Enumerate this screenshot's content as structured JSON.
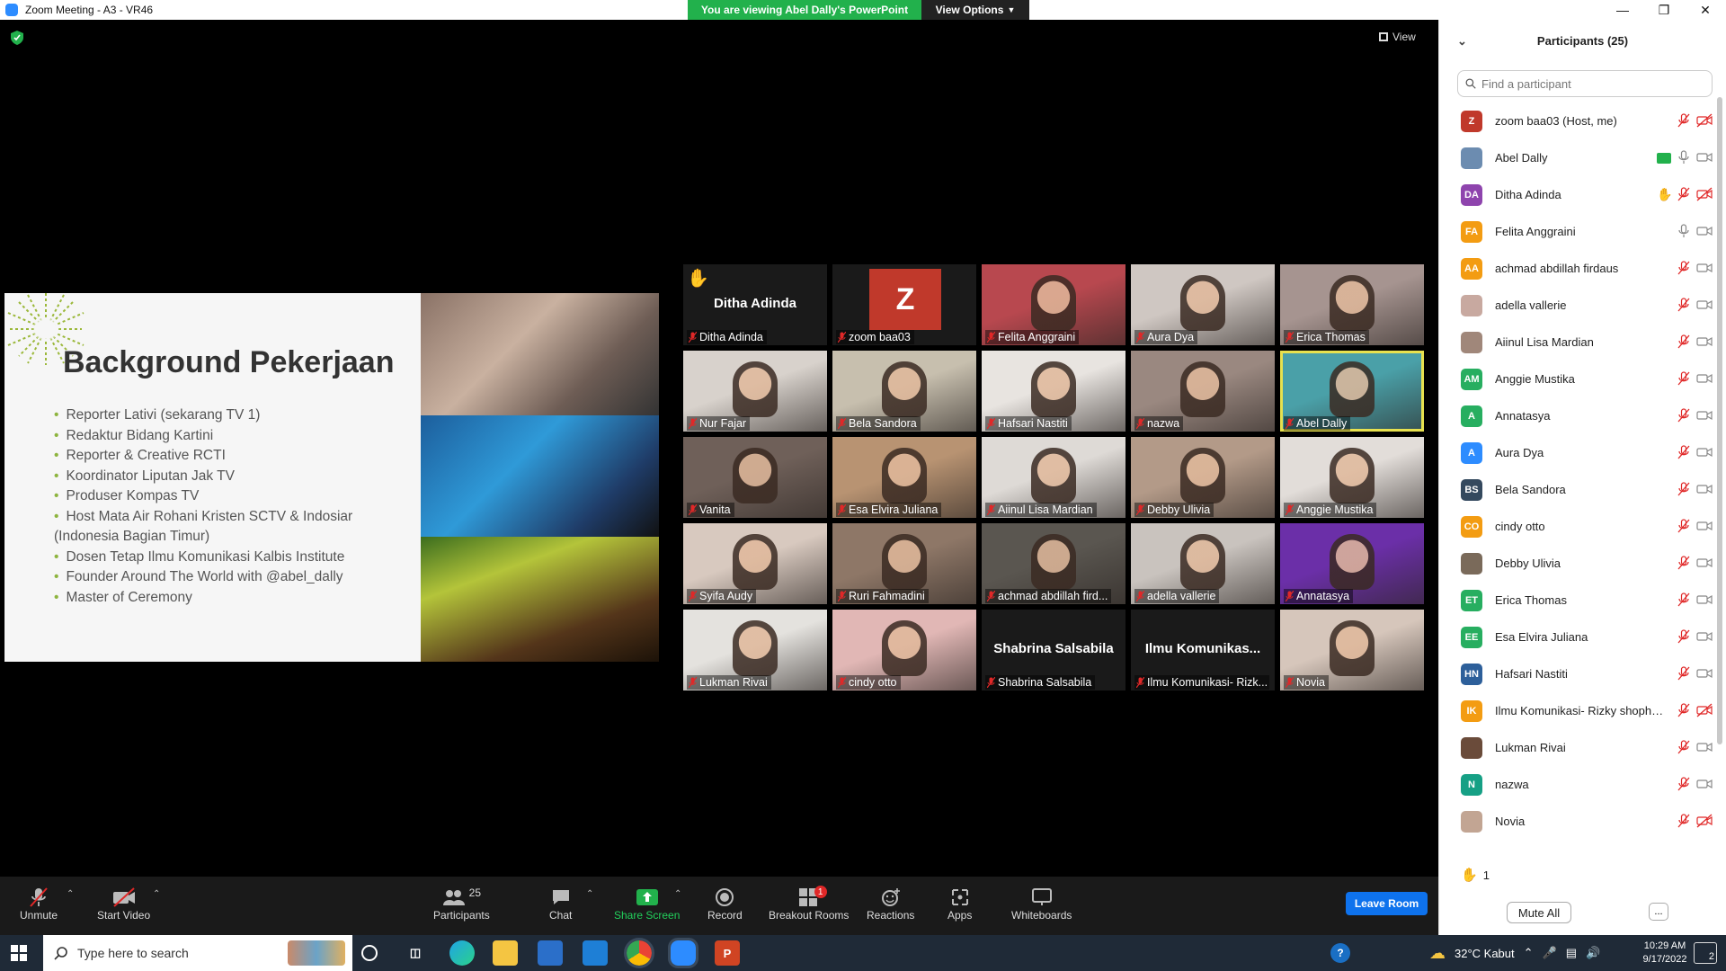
{
  "window": {
    "title": "Zoom Meeting - A3 - VR46",
    "viewing_banner": "You are viewing Abel Dally's PowerPoint",
    "view_options": "View Options",
    "view_label": "View"
  },
  "slide": {
    "title": "Background Pekerjaan",
    "bullets": [
      "Reporter Lativi (sekarang TV 1)",
      "Redaktur Bidang Kartini",
      "Reporter & Creative RCTI",
      "Koordinator Liputan Jak TV",
      "Produser Kompas TV",
      "Host Mata Air Rohani Kristen SCTV & Indosiar (Indonesia Bagian Timur)",
      "Dosen Tetap Ilmu Komunikasi Kalbis Institute",
      "Founder Around The World with @abel_dally",
      "Master of Ceremony"
    ]
  },
  "tiles": [
    {
      "label": "Ditha Adinda",
      "big": "Ditha Adinda",
      "hand": true
    },
    {
      "label": "zoom baa03",
      "avatar": "Z"
    },
    {
      "label": "Felita Anggraini",
      "bg": "#b8484f"
    },
    {
      "label": "Aura Dya",
      "bg": "#cfc7c2"
    },
    {
      "label": "Erica Thomas",
      "bg": "#a69490"
    },
    {
      "label": "Nur Fajar",
      "bg": "#d8d2cc"
    },
    {
      "label": "Bela Sandora",
      "bg": "#c7bfae"
    },
    {
      "label": "Hafsari Nastiti",
      "bg": "#e8e4e0"
    },
    {
      "label": "nazwa",
      "bg": "#9a8880"
    },
    {
      "label": "Abel Dally",
      "bg": "#4aa0a8",
      "active": true
    },
    {
      "label": "Vanita",
      "bg": "#6f6059"
    },
    {
      "label": "Esa Elvira Juliana",
      "bg": "#b89372"
    },
    {
      "label": "Aiinul Lisa Mardian",
      "bg": "#dedad6"
    },
    {
      "label": "Debby Ulivia",
      "bg": "#b39a88"
    },
    {
      "label": "Anggie Mustika",
      "bg": "#e2ddd9"
    },
    {
      "label": "Syifa Audy",
      "bg": "#d8c9bf"
    },
    {
      "label": "Ruri Fahmadini",
      "bg": "#8e7767"
    },
    {
      "label": "achmad abdillah fird...",
      "bg": "#5a5650"
    },
    {
      "label": "adella vallerie",
      "bg": "#c9c3be"
    },
    {
      "label": "Annatasya",
      "bg": "#6b2fa8"
    },
    {
      "label": "Lukman Rivai",
      "bg": "#e4e2de"
    },
    {
      "label": "cindy otto",
      "bg": "#e1b7b5"
    },
    {
      "label": "Shabrina Salsabila",
      "big": "Shabrina Salsabila"
    },
    {
      "label": "Ilmu Komunikasi- Rizk...",
      "big": "Ilmu  Komunikas..."
    },
    {
      "label": "Novia",
      "bg": "#d6c6bb"
    }
  ],
  "panel": {
    "title": "Participants (25)",
    "search_placeholder": "Find a participant",
    "participants": [
      {
        "name": "zoom baa03 (Host, me)",
        "initials": "Z",
        "color": "#c0392b",
        "mic": "off",
        "video": "off"
      },
      {
        "name": "Abel Dally",
        "initials": "",
        "color": "#6c8cb0",
        "mic": "on",
        "video": "on",
        "share": true
      },
      {
        "name": "Ditha Adinda",
        "initials": "DA",
        "color": "#8e44ad",
        "mic": "off",
        "video": "off",
        "hand": true
      },
      {
        "name": "Felita Anggraini",
        "initials": "FA",
        "color": "#f39c12",
        "mic": "on",
        "video": "on"
      },
      {
        "name": "achmad abdillah firdaus",
        "initials": "AA",
        "color": "#f39c12",
        "mic": "off",
        "video": "on"
      },
      {
        "name": "adella vallerie",
        "initials": "",
        "color": "#c8a9a0",
        "mic": "off",
        "video": "on"
      },
      {
        "name": "Aiinul Lisa Mardian",
        "initials": "",
        "color": "#a0877a",
        "mic": "off",
        "video": "on"
      },
      {
        "name": "Anggie Mustika",
        "initials": "AM",
        "color": "#27ae60",
        "mic": "off",
        "video": "on"
      },
      {
        "name": "Annatasya",
        "initials": "A",
        "color": "#27ae60",
        "mic": "off",
        "video": "on"
      },
      {
        "name": "Aura Dya",
        "initials": "A",
        "color": "#2d8cff",
        "mic": "off",
        "video": "on"
      },
      {
        "name": "Bela Sandora",
        "initials": "BS",
        "color": "#34495e",
        "mic": "off",
        "video": "on"
      },
      {
        "name": "cindy otto",
        "initials": "CO",
        "color": "#f39c12",
        "mic": "off",
        "video": "on"
      },
      {
        "name": "Debby Ulivia",
        "initials": "",
        "color": "#7a6a5a",
        "mic": "off",
        "video": "on"
      },
      {
        "name": "Erica Thomas",
        "initials": "ET",
        "color": "#27ae60",
        "mic": "off",
        "video": "on"
      },
      {
        "name": "Esa Elvira Juliana",
        "initials": "EE",
        "color": "#27ae60",
        "mic": "off",
        "video": "on"
      },
      {
        "name": "Hafsari Nastiti",
        "initials": "HN",
        "color": "#2d5f9a",
        "mic": "off",
        "video": "on"
      },
      {
        "name": "Ilmu Komunikasi- Rizky shophia...",
        "initials": "IK",
        "color": "#f39c12",
        "mic": "off",
        "video": "off"
      },
      {
        "name": "Lukman Rivai",
        "initials": "",
        "color": "#6a4b3a",
        "mic": "off",
        "video": "on"
      },
      {
        "name": "nazwa",
        "initials": "N",
        "color": "#16a085",
        "mic": "off",
        "video": "on"
      },
      {
        "name": "Novia",
        "initials": "",
        "color": "#c2a593",
        "mic": "off",
        "video": "off"
      }
    ],
    "raised_hands": "1",
    "mute_all": "Mute All",
    "more": "..."
  },
  "toolbar": {
    "unmute": "Unmute",
    "start_video": "Start Video",
    "participants": "Participants",
    "participants_count": "25",
    "chat": "Chat",
    "share_screen": "Share Screen",
    "record": "Record",
    "breakout_rooms": "Breakout Rooms",
    "breakout_badge": "1",
    "reactions": "Reactions",
    "apps": "Apps",
    "whiteboards": "Whiteboards",
    "leave": "Leave Room"
  },
  "taskbar": {
    "search_placeholder": "Type here to search",
    "weather": "32°C  Kabut",
    "time": "10:29 AM",
    "date": "9/17/2022",
    "notifications": "2"
  },
  "colors": {
    "accent": "#0e72ed",
    "banner": "#22b14c",
    "muted_red": "#e02828",
    "active_speaker": "#e7e14f"
  }
}
